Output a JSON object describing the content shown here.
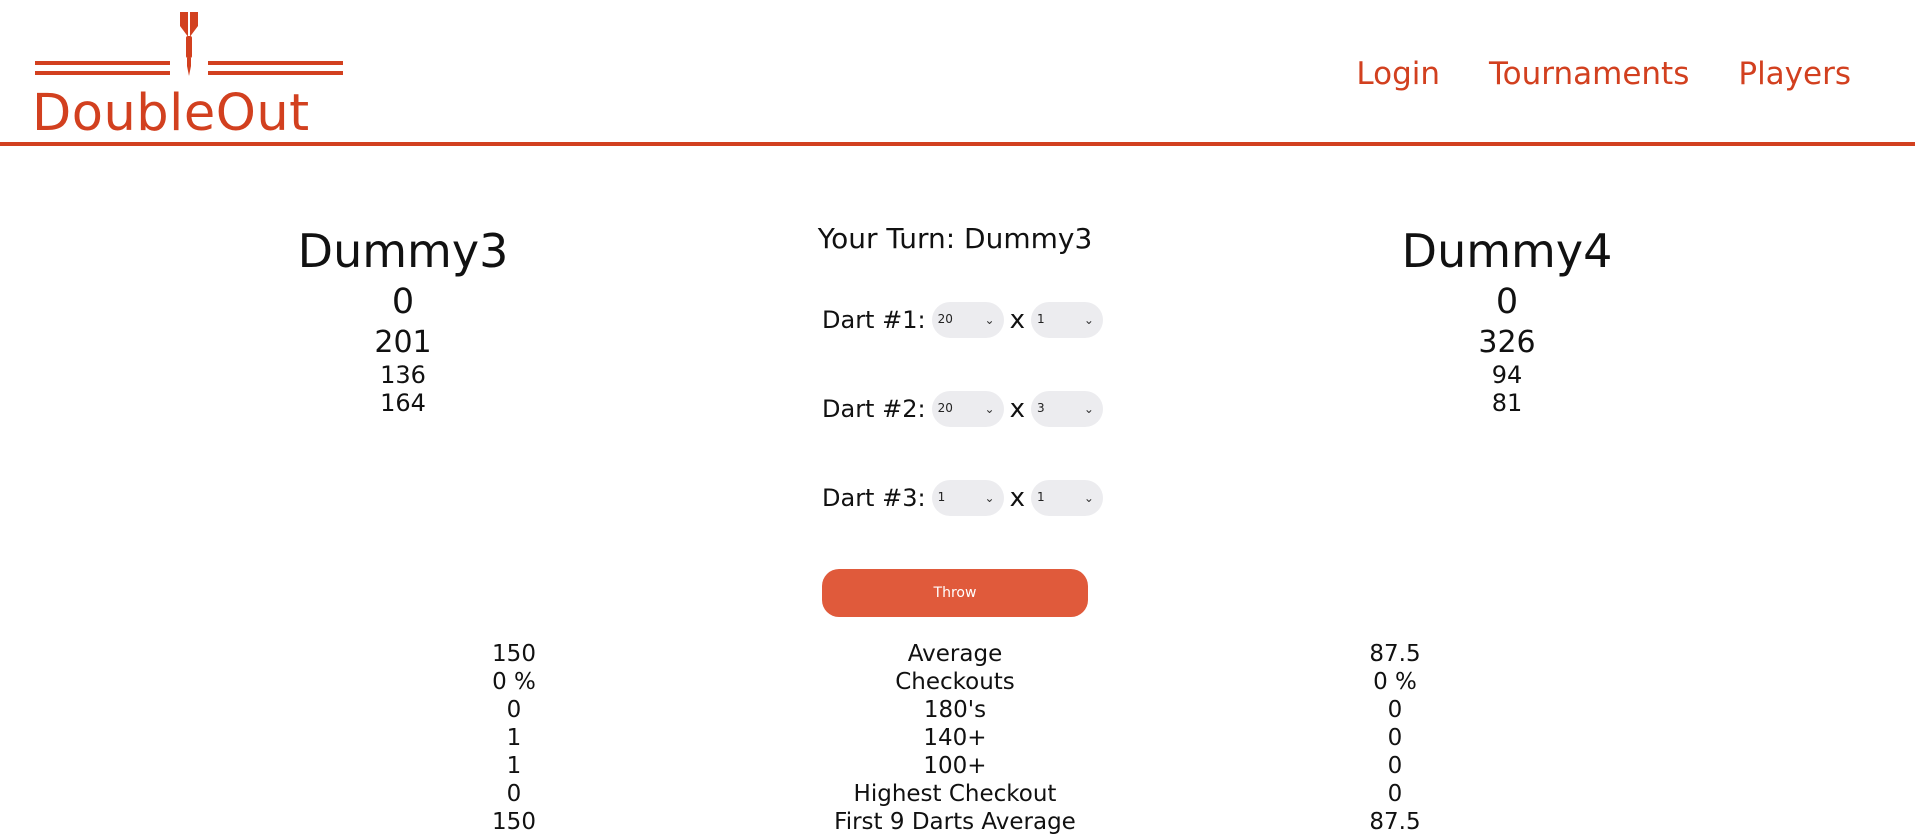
{
  "brand": {
    "name": "DoubleOut",
    "logo_icon": "dart-icon",
    "accent": "#d2401f"
  },
  "nav": [
    {
      "label": "Login"
    },
    {
      "label": "Tournaments"
    },
    {
      "label": "Players"
    }
  ],
  "players": [
    {
      "name": "Dummy3",
      "score": "0",
      "remaining": "201",
      "line2": "136",
      "line3": "164"
    },
    {
      "name": "Dummy4",
      "score": "0",
      "remaining": "326",
      "line2": "94",
      "line3": "81"
    }
  ],
  "turn": {
    "label": "Your Turn: Dummy3"
  },
  "darts": [
    {
      "label": "Dart #1:",
      "segment": "20",
      "multiplier": "1"
    },
    {
      "label": "Dart #2:",
      "segment": "20",
      "multiplier": "3"
    },
    {
      "label": "Dart #3:",
      "segment": "1",
      "multiplier": "1"
    }
  ],
  "times_symbol": "x",
  "throw_label": "Throw",
  "throw_color": "#e05a3b",
  "stats": [
    {
      "label": "Average",
      "p1": "150",
      "p2": "87.5"
    },
    {
      "label": "Checkouts",
      "p1": "0 %",
      "p2": "0 %"
    },
    {
      "label": "180's",
      "p1": "0",
      "p2": "0"
    },
    {
      "label": "140+",
      "p1": "1",
      "p2": "0"
    },
    {
      "label": "100+",
      "p1": "1",
      "p2": "0"
    },
    {
      "label": "Highest Checkout",
      "p1": "0",
      "p2": "0"
    },
    {
      "label": "First 9 Darts Average",
      "p1": "150",
      "p2": "87.5"
    }
  ]
}
